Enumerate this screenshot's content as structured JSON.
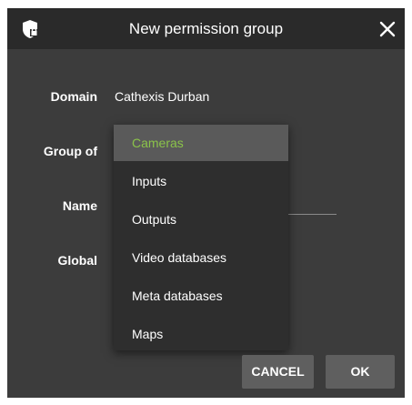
{
  "dialog": {
    "title": "New permission group",
    "icon": "shield-lock-icon",
    "close_icon": "close-icon"
  },
  "form": {
    "domain_label": "Domain",
    "domain_value": "Cathexis Durban",
    "group_of_label": "Group of",
    "name_label": "Name",
    "global_label": "Global"
  },
  "dropdown": {
    "selected": "Cameras",
    "options": [
      "Cameras",
      "Inputs",
      "Outputs",
      "Video databases",
      "Meta databases",
      "Maps"
    ],
    "selected_color": "#8bc34a"
  },
  "buttons": {
    "cancel_label": "CANCEL",
    "ok_label": "OK"
  }
}
